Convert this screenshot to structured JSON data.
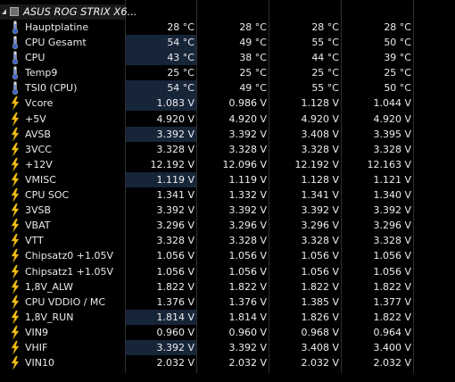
{
  "group": {
    "title": "ASUS ROG STRIX X6..."
  },
  "rows": [
    {
      "label": "Hauptplatine",
      "icon": "thermometer-icon",
      "values": [
        "28 °C",
        "28 °C",
        "28 °C",
        "28 °C"
      ],
      "highlight": false
    },
    {
      "label": "CPU Gesamt",
      "icon": "thermometer-icon",
      "values": [
        "54 °C",
        "49 °C",
        "55 °C",
        "50 °C"
      ],
      "highlight": true
    },
    {
      "label": "CPU",
      "icon": "thermometer-icon",
      "values": [
        "43 °C",
        "38 °C",
        "44 °C",
        "39 °C"
      ],
      "highlight": true
    },
    {
      "label": "Temp9",
      "icon": "thermometer-icon",
      "values": [
        "25 °C",
        "25 °C",
        "25 °C",
        "25 °C"
      ],
      "highlight": false
    },
    {
      "label": "TSI0 (CPU)",
      "icon": "thermometer-icon",
      "values": [
        "54 °C",
        "49 °C",
        "55 °C",
        "50 °C"
      ],
      "highlight": true
    },
    {
      "label": "Vcore",
      "icon": "lightning-icon",
      "values": [
        "1.083 V",
        "0.986 V",
        "1.128 V",
        "1.044 V"
      ],
      "highlight": true
    },
    {
      "label": "+5V",
      "icon": "lightning-icon",
      "values": [
        "4.920 V",
        "4.920 V",
        "4.920 V",
        "4.920 V"
      ],
      "highlight": false
    },
    {
      "label": "AVSB",
      "icon": "lightning-icon",
      "values": [
        "3.392 V",
        "3.392 V",
        "3.408 V",
        "3.395 V"
      ],
      "highlight": true
    },
    {
      "label": "3VCC",
      "icon": "lightning-icon",
      "values": [
        "3.328 V",
        "3.328 V",
        "3.328 V",
        "3.328 V"
      ],
      "highlight": false
    },
    {
      "label": "+12V",
      "icon": "lightning-icon",
      "values": [
        "12.192 V",
        "12.096 V",
        "12.192 V",
        "12.163 V"
      ],
      "highlight": false
    },
    {
      "label": "VMISC",
      "icon": "lightning-icon",
      "values": [
        "1.119 V",
        "1.119 V",
        "1.128 V",
        "1.121 V"
      ],
      "highlight": true
    },
    {
      "label": "CPU SOC",
      "icon": "lightning-icon",
      "values": [
        "1.341 V",
        "1.332 V",
        "1.341 V",
        "1.340 V"
      ],
      "highlight": false
    },
    {
      "label": "3VSB",
      "icon": "lightning-icon",
      "values": [
        "3.392 V",
        "3.392 V",
        "3.392 V",
        "3.392 V"
      ],
      "highlight": false
    },
    {
      "label": "VBAT",
      "icon": "lightning-icon",
      "values": [
        "3.296 V",
        "3.296 V",
        "3.296 V",
        "3.296 V"
      ],
      "highlight": false
    },
    {
      "label": "VTT",
      "icon": "lightning-icon",
      "values": [
        "3.328 V",
        "3.328 V",
        "3.328 V",
        "3.328 V"
      ],
      "highlight": false
    },
    {
      "label": "Chipsatz0 +1.05V",
      "icon": "lightning-icon",
      "values": [
        "1.056 V",
        "1.056 V",
        "1.056 V",
        "1.056 V"
      ],
      "highlight": false
    },
    {
      "label": "Chipsatz1 +1.05V",
      "icon": "lightning-icon",
      "values": [
        "1.056 V",
        "1.056 V",
        "1.056 V",
        "1.056 V"
      ],
      "highlight": false
    },
    {
      "label": "1,8V_ALW",
      "icon": "lightning-icon",
      "values": [
        "1.822 V",
        "1.822 V",
        "1.822 V",
        "1.822 V"
      ],
      "highlight": false
    },
    {
      "label": "CPU VDDIO / MC",
      "icon": "lightning-icon",
      "values": [
        "1.376 V",
        "1.376 V",
        "1.385 V",
        "1.377 V"
      ],
      "highlight": false
    },
    {
      "label": "1,8V_RUN",
      "icon": "lightning-icon",
      "values": [
        "1.814 V",
        "1.814 V",
        "1.826 V",
        "1.822 V"
      ],
      "highlight": true
    },
    {
      "label": "VIN9",
      "icon": "lightning-icon",
      "values": [
        "0.960 V",
        "0.960 V",
        "0.968 V",
        "0.964 V"
      ],
      "highlight": false
    },
    {
      "label": "VHIF",
      "icon": "lightning-icon",
      "values": [
        "3.392 V",
        "3.392 V",
        "3.408 V",
        "3.400 V"
      ],
      "highlight": true
    },
    {
      "label": "VIN10",
      "icon": "lightning-icon",
      "values": [
        "2.032 V",
        "2.032 V",
        "2.032 V",
        "2.032 V"
      ],
      "highlight": false
    }
  ],
  "colors": {
    "background": "#000000",
    "highlight_cell": "#172539",
    "gridline": "#2e2e2e",
    "lightning": "#f2c21a"
  }
}
